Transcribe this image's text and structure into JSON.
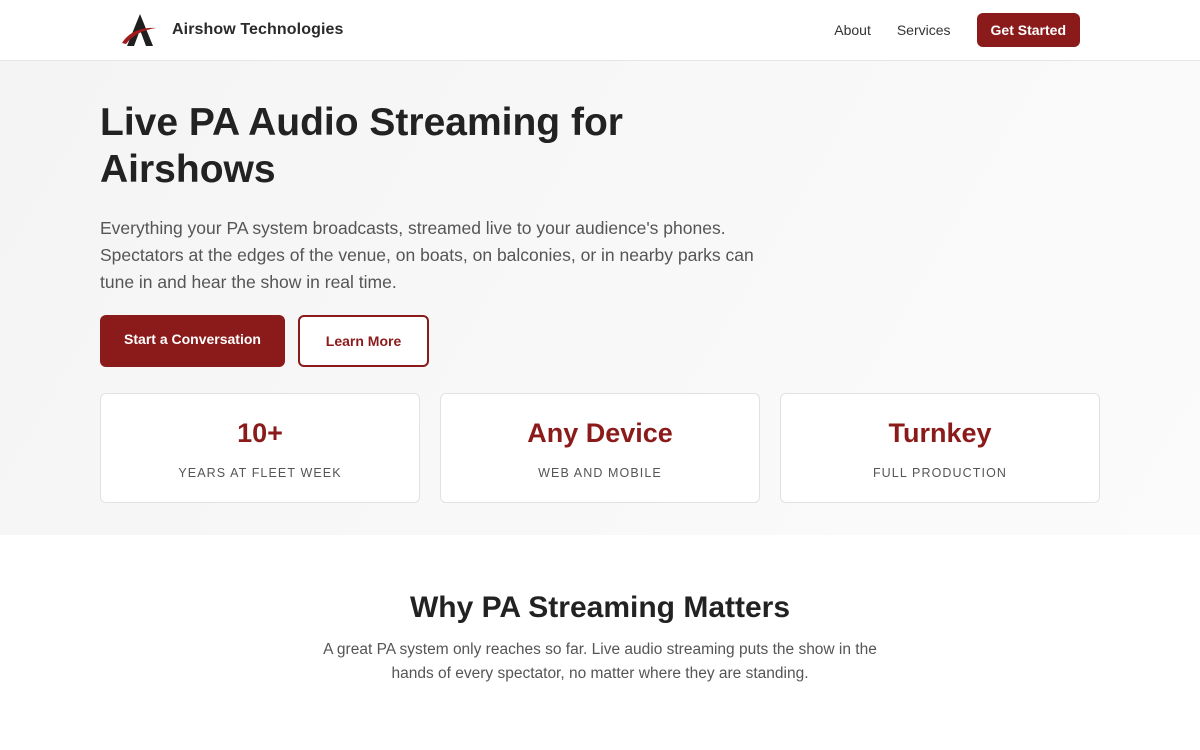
{
  "header": {
    "brand_name": "Airshow Technologies",
    "logo_icon": "airplane-delta-logo",
    "nav": [
      {
        "label": "About"
      },
      {
        "label": "Services"
      }
    ],
    "cta_label": "Get Started"
  },
  "hero": {
    "title": "Live PA Audio Streaming for Airshows",
    "description": "Everything your PA system broadcasts, streamed live to your audience's phones. Spectators at the edges of the venue, on boats, on balconies, or in nearby parks can tune in and hear the show in real time.",
    "primary_button": "Start a Conversation",
    "secondary_button": "Learn More"
  },
  "stats": [
    {
      "value": "10+",
      "label": "YEARS AT FLEET WEEK"
    },
    {
      "value": "Any Device",
      "label": "WEB AND MOBILE"
    },
    {
      "value": "Turnkey",
      "label": "FULL PRODUCTION"
    }
  ],
  "why": {
    "title": "Why PA Streaming Matters",
    "description": "A great PA system only reaches so far. Live audio streaming puts the show in the hands of every spectator, no matter where they are standing."
  },
  "colors": {
    "accent": "#8b1a1a",
    "text": "#222222",
    "muted": "#555555"
  }
}
